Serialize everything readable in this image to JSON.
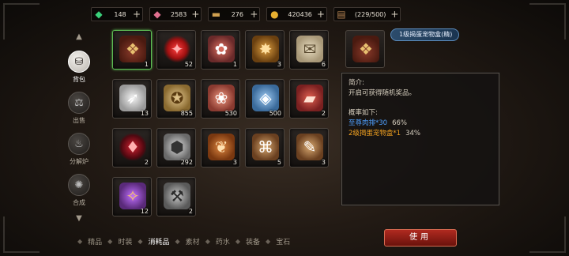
{
  "currencies": [
    {
      "icon": "green-gem-icon",
      "glyph": "◆",
      "color": "#3ad07a",
      "value": "148"
    },
    {
      "icon": "pink-gem-icon",
      "glyph": "◆",
      "color": "#e07090",
      "value": "2583"
    },
    {
      "icon": "gold-ticket-icon",
      "glyph": "▬",
      "color": "#d0a050",
      "value": "276"
    },
    {
      "icon": "gold-coins-icon",
      "glyph": "●",
      "color": "#e8b030",
      "value": "420436"
    },
    {
      "icon": "bag-capacity-icon",
      "glyph": "▤",
      "color": "#b08050",
      "value": "(229/500)"
    }
  ],
  "left_nav": {
    "up_arrow": "▲",
    "down_arrow": "▼",
    "items": [
      {
        "id": "bag",
        "label": "背包",
        "glyph": "⛁",
        "active": true
      },
      {
        "id": "sell",
        "label": "出售",
        "glyph": "⚖",
        "active": false
      },
      {
        "id": "decompose",
        "label": "分解炉",
        "glyph": "♨",
        "active": false
      },
      {
        "id": "synth",
        "label": "合成",
        "glyph": "✺",
        "active": false
      }
    ]
  },
  "grid_items": [
    {
      "name": "pet-egg-chest",
      "cls": "it-chest",
      "glyph": "❖",
      "count": "1",
      "selected": true
    },
    {
      "name": "red-crystal",
      "cls": "it-ruby",
      "glyph": "✦",
      "count": "52",
      "selected": false
    },
    {
      "name": "claw-pouch",
      "cls": "it-claw",
      "glyph": "✿",
      "count": "1",
      "selected": false
    },
    {
      "name": "gold-rune",
      "cls": "it-rune",
      "glyph": "✸",
      "count": "3",
      "selected": false
    },
    {
      "name": "scroll",
      "cls": "it-scroll",
      "glyph": "✉",
      "count": "6",
      "selected": false
    },
    {
      "name": "white-feather",
      "cls": "it-feather",
      "glyph": "➶",
      "count": "13",
      "selected": false
    },
    {
      "name": "gold-badge",
      "cls": "it-gold",
      "glyph": "✪",
      "count": "855",
      "selected": false
    },
    {
      "name": "paw-badge",
      "cls": "it-paw",
      "glyph": "❀",
      "count": "530",
      "selected": false
    },
    {
      "name": "blue-badge",
      "cls": "it-blue",
      "glyph": "◈",
      "count": "500",
      "selected": false
    },
    {
      "name": "meat",
      "cls": "it-meat",
      "glyph": "▰",
      "count": "2",
      "selected": false
    },
    {
      "name": "red-shard",
      "cls": "it-shard",
      "glyph": "♦",
      "count": "2",
      "selected": false
    },
    {
      "name": "silver-badge",
      "cls": "it-silver",
      "glyph": "⬢",
      "count": "292",
      "selected": false
    },
    {
      "name": "drumstick",
      "cls": "it-leg",
      "glyph": "❦",
      "count": "3",
      "selected": false
    },
    {
      "name": "bamboo-scroll",
      "cls": "it-stick",
      "glyph": "⌘",
      "count": "5",
      "selected": false
    },
    {
      "name": "paint-brush",
      "cls": "it-stick",
      "glyph": "✎",
      "count": "3",
      "selected": false
    },
    {
      "name": "treasure-bag",
      "cls": "it-bag",
      "glyph": "✧",
      "count": "12",
      "selected": false
    },
    {
      "name": "hammer",
      "cls": "it-hammer",
      "glyph": "⚒",
      "count": "2",
      "selected": false
    }
  ],
  "detail": {
    "item_name": "1级揭蛋宠物盒(精)",
    "intro_label": "简介:",
    "intro_text": "开启可获得随机奖品。",
    "prob_label": "概率如下:",
    "drops": [
      {
        "name": "至尊肉排*30",
        "pct": "66%",
        "color": "blue"
      },
      {
        "name": "2级揭蛋宠物盒*1",
        "pct": "34%",
        "color": "orange"
      }
    ]
  },
  "tabs": [
    "精品",
    "时装",
    "消耗品",
    "素材",
    "药水",
    "装备",
    "宝石"
  ],
  "active_tab": "消耗品",
  "use_button": "使用"
}
